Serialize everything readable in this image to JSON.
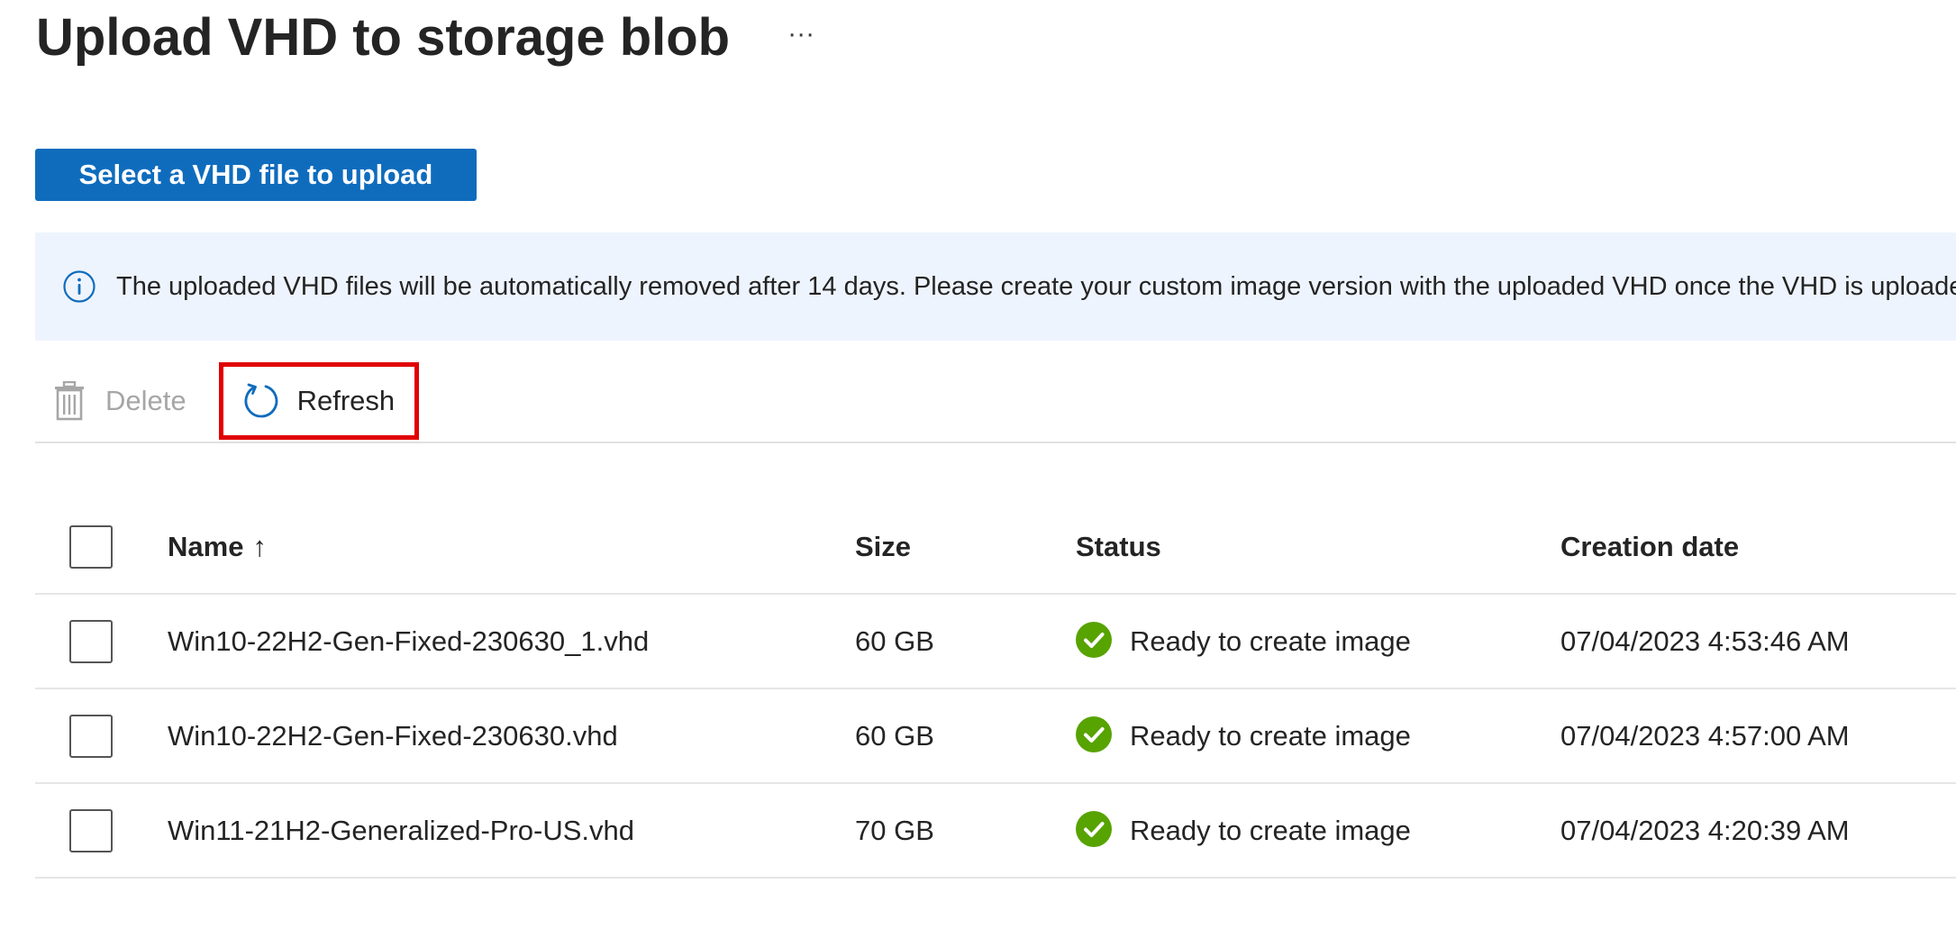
{
  "page": {
    "title": "Upload VHD to storage blob",
    "more_label": "···"
  },
  "actions": {
    "upload_label": "Select a VHD file to upload"
  },
  "banner": {
    "text": "The uploaded VHD files will be automatically removed after 14 days. Please create your custom image version with the uploaded VHD once the VHD is uploaded",
    "icon": "info-icon"
  },
  "toolbar": {
    "delete_label": "Delete",
    "refresh_label": "Refresh"
  },
  "table": {
    "headers": {
      "name": "Name",
      "sort_indicator": "↑",
      "size": "Size",
      "status": "Status",
      "creation_date": "Creation date"
    },
    "rows": [
      {
        "name": "Win10-22H2-Gen-Fixed-230630_1.vhd",
        "size": "60 GB",
        "status": "Ready to create image",
        "creation_date": "07/04/2023 4:53:46 AM"
      },
      {
        "name": "Win10-22H2-Gen-Fixed-230630.vhd",
        "size": "60 GB",
        "status": "Ready to create image",
        "creation_date": "07/04/2023 4:57:00 AM"
      },
      {
        "name": "Win11-21H2-Generalized-Pro-US.vhd",
        "size": "70 GB",
        "status": "Ready to create image",
        "creation_date": "07/04/2023 4:20:39 AM"
      }
    ]
  },
  "colors": {
    "primary": "#0f6cbd",
    "banner_bg": "#eef4fd",
    "success": "#57a300",
    "highlight": "#e00000"
  }
}
